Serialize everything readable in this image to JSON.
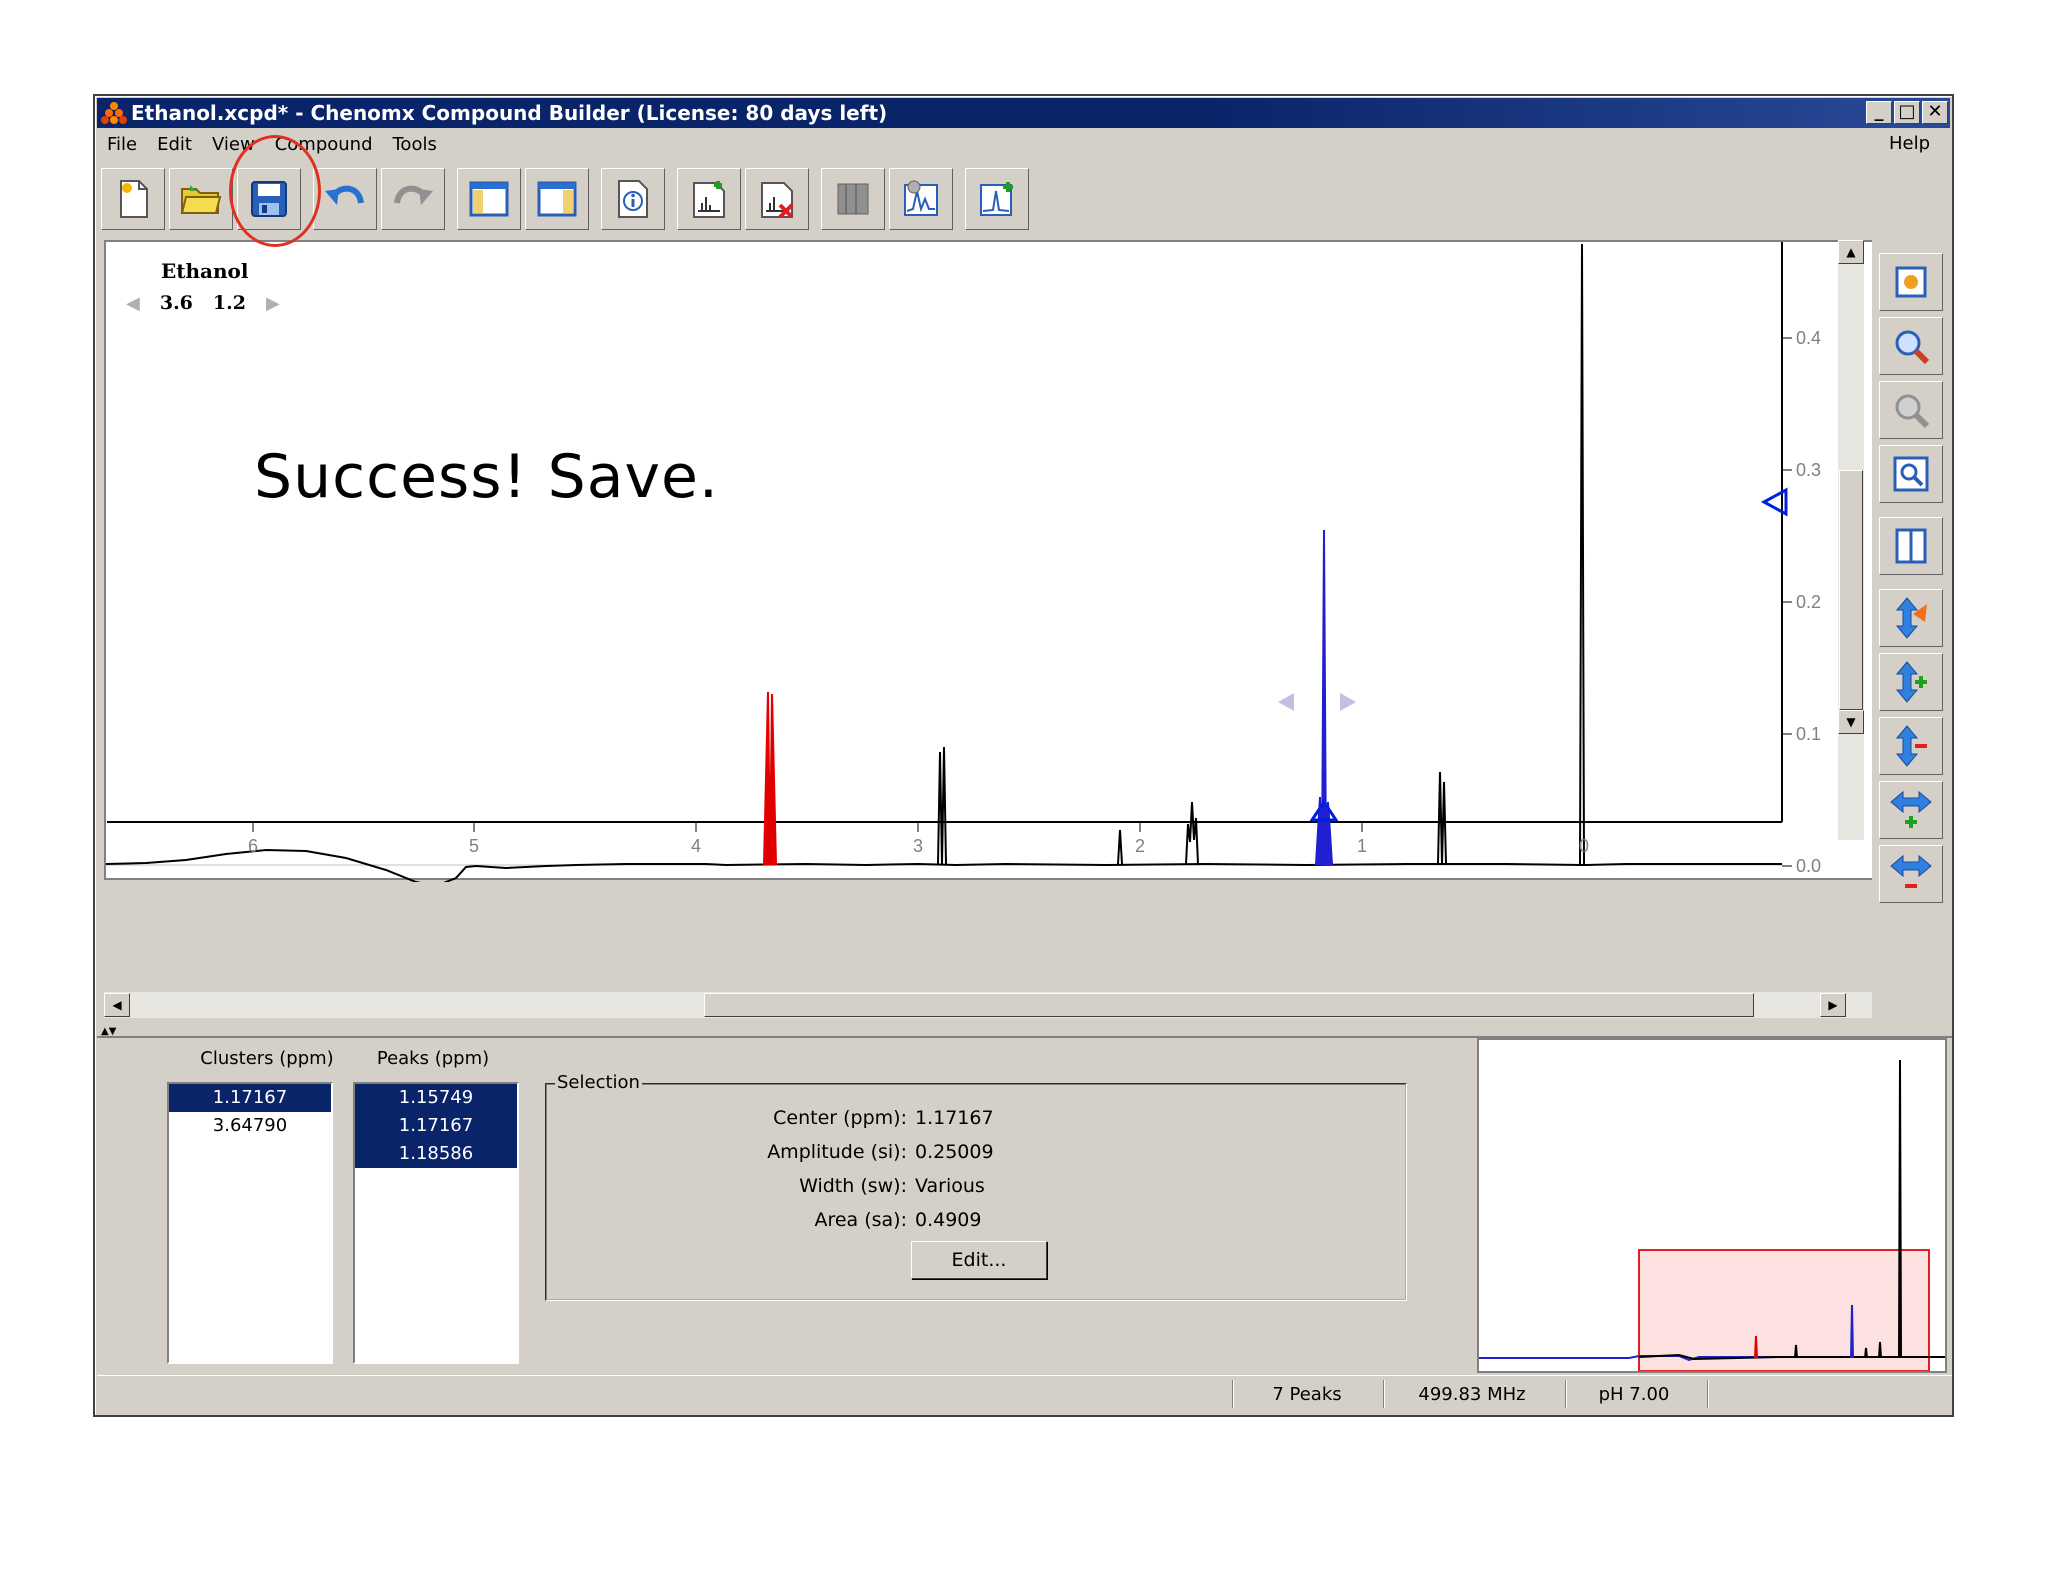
{
  "window": {
    "title": "Ethanol.xcpd* - Chenomx Compound Builder (License: 80 days left)",
    "controls": [
      "_",
      "□",
      "✕"
    ]
  },
  "menu": {
    "items": [
      "File",
      "Edit",
      "View",
      "Compound",
      "Tools"
    ],
    "help": "Help"
  },
  "toolbar": {
    "buttons": [
      {
        "icon": "new-document-icon"
      },
      {
        "icon": "open-folder-icon"
      },
      {
        "icon": "save-icon"
      },
      {
        "icon": "undo-icon"
      },
      {
        "icon": "redo-icon"
      },
      {
        "icon": "left-panel-icon"
      },
      {
        "icon": "right-panel-icon"
      },
      {
        "icon": "info-icon"
      },
      {
        "icon": "add-peak-icon"
      },
      {
        "icon": "delete-peak-icon"
      },
      {
        "icon": "cluster-icon"
      },
      {
        "icon": "spectrum-settings-icon"
      },
      {
        "icon": "add-spectrum-icon"
      }
    ],
    "highlight_color": "#e03020"
  },
  "plot": {
    "compound_name": "Ethanol",
    "clusters": [
      "3.6",
      "1.2"
    ],
    "annotation": "Success! Save.",
    "x_ticks": [
      "6",
      "5",
      "4",
      "3",
      "2",
      "1",
      "0"
    ],
    "y_ticks": [
      "0.4",
      "0.3",
      "0.2",
      "0.1",
      "0.0"
    ],
    "colors": {
      "cluster_a": "#e00000",
      "cluster_b": "#2020d0",
      "spectrum": "#000000"
    }
  },
  "side_tools": {
    "icons": [
      "zoom-fit-icon",
      "zoom-in-icon",
      "zoom-out-icon",
      "zoom-window-icon",
      "split-view-icon",
      "vertical-auto-icon",
      "vertical-increase-icon",
      "vertical-decrease-icon",
      "horizontal-increase-icon",
      "horizontal-decrease-icon"
    ]
  },
  "clusters_panel": {
    "label": "Clusters (ppm)",
    "items": [
      {
        "value": "1.17167",
        "selected": true
      },
      {
        "value": "3.64790",
        "selected": false
      }
    ]
  },
  "peaks_panel": {
    "label": "Peaks (ppm)",
    "items": [
      {
        "value": "1.15749",
        "selected": true
      },
      {
        "value": "1.17167",
        "selected": true
      },
      {
        "value": "1.18586",
        "selected": true
      }
    ]
  },
  "selection": {
    "legend": "Selection",
    "center_label": "Center (ppm):",
    "center_value": "1.17167",
    "amplitude_label": "Amplitude (si):",
    "amplitude_value": "0.25009",
    "width_label": "Width (sw):",
    "width_value": "Various",
    "area_label": "Area (sa):",
    "area_value": "0.4909",
    "edit_button": "Edit..."
  },
  "status": {
    "peaks": "7 Peaks",
    "frequency": "499.83 MHz",
    "ph": "pH 7.00"
  }
}
